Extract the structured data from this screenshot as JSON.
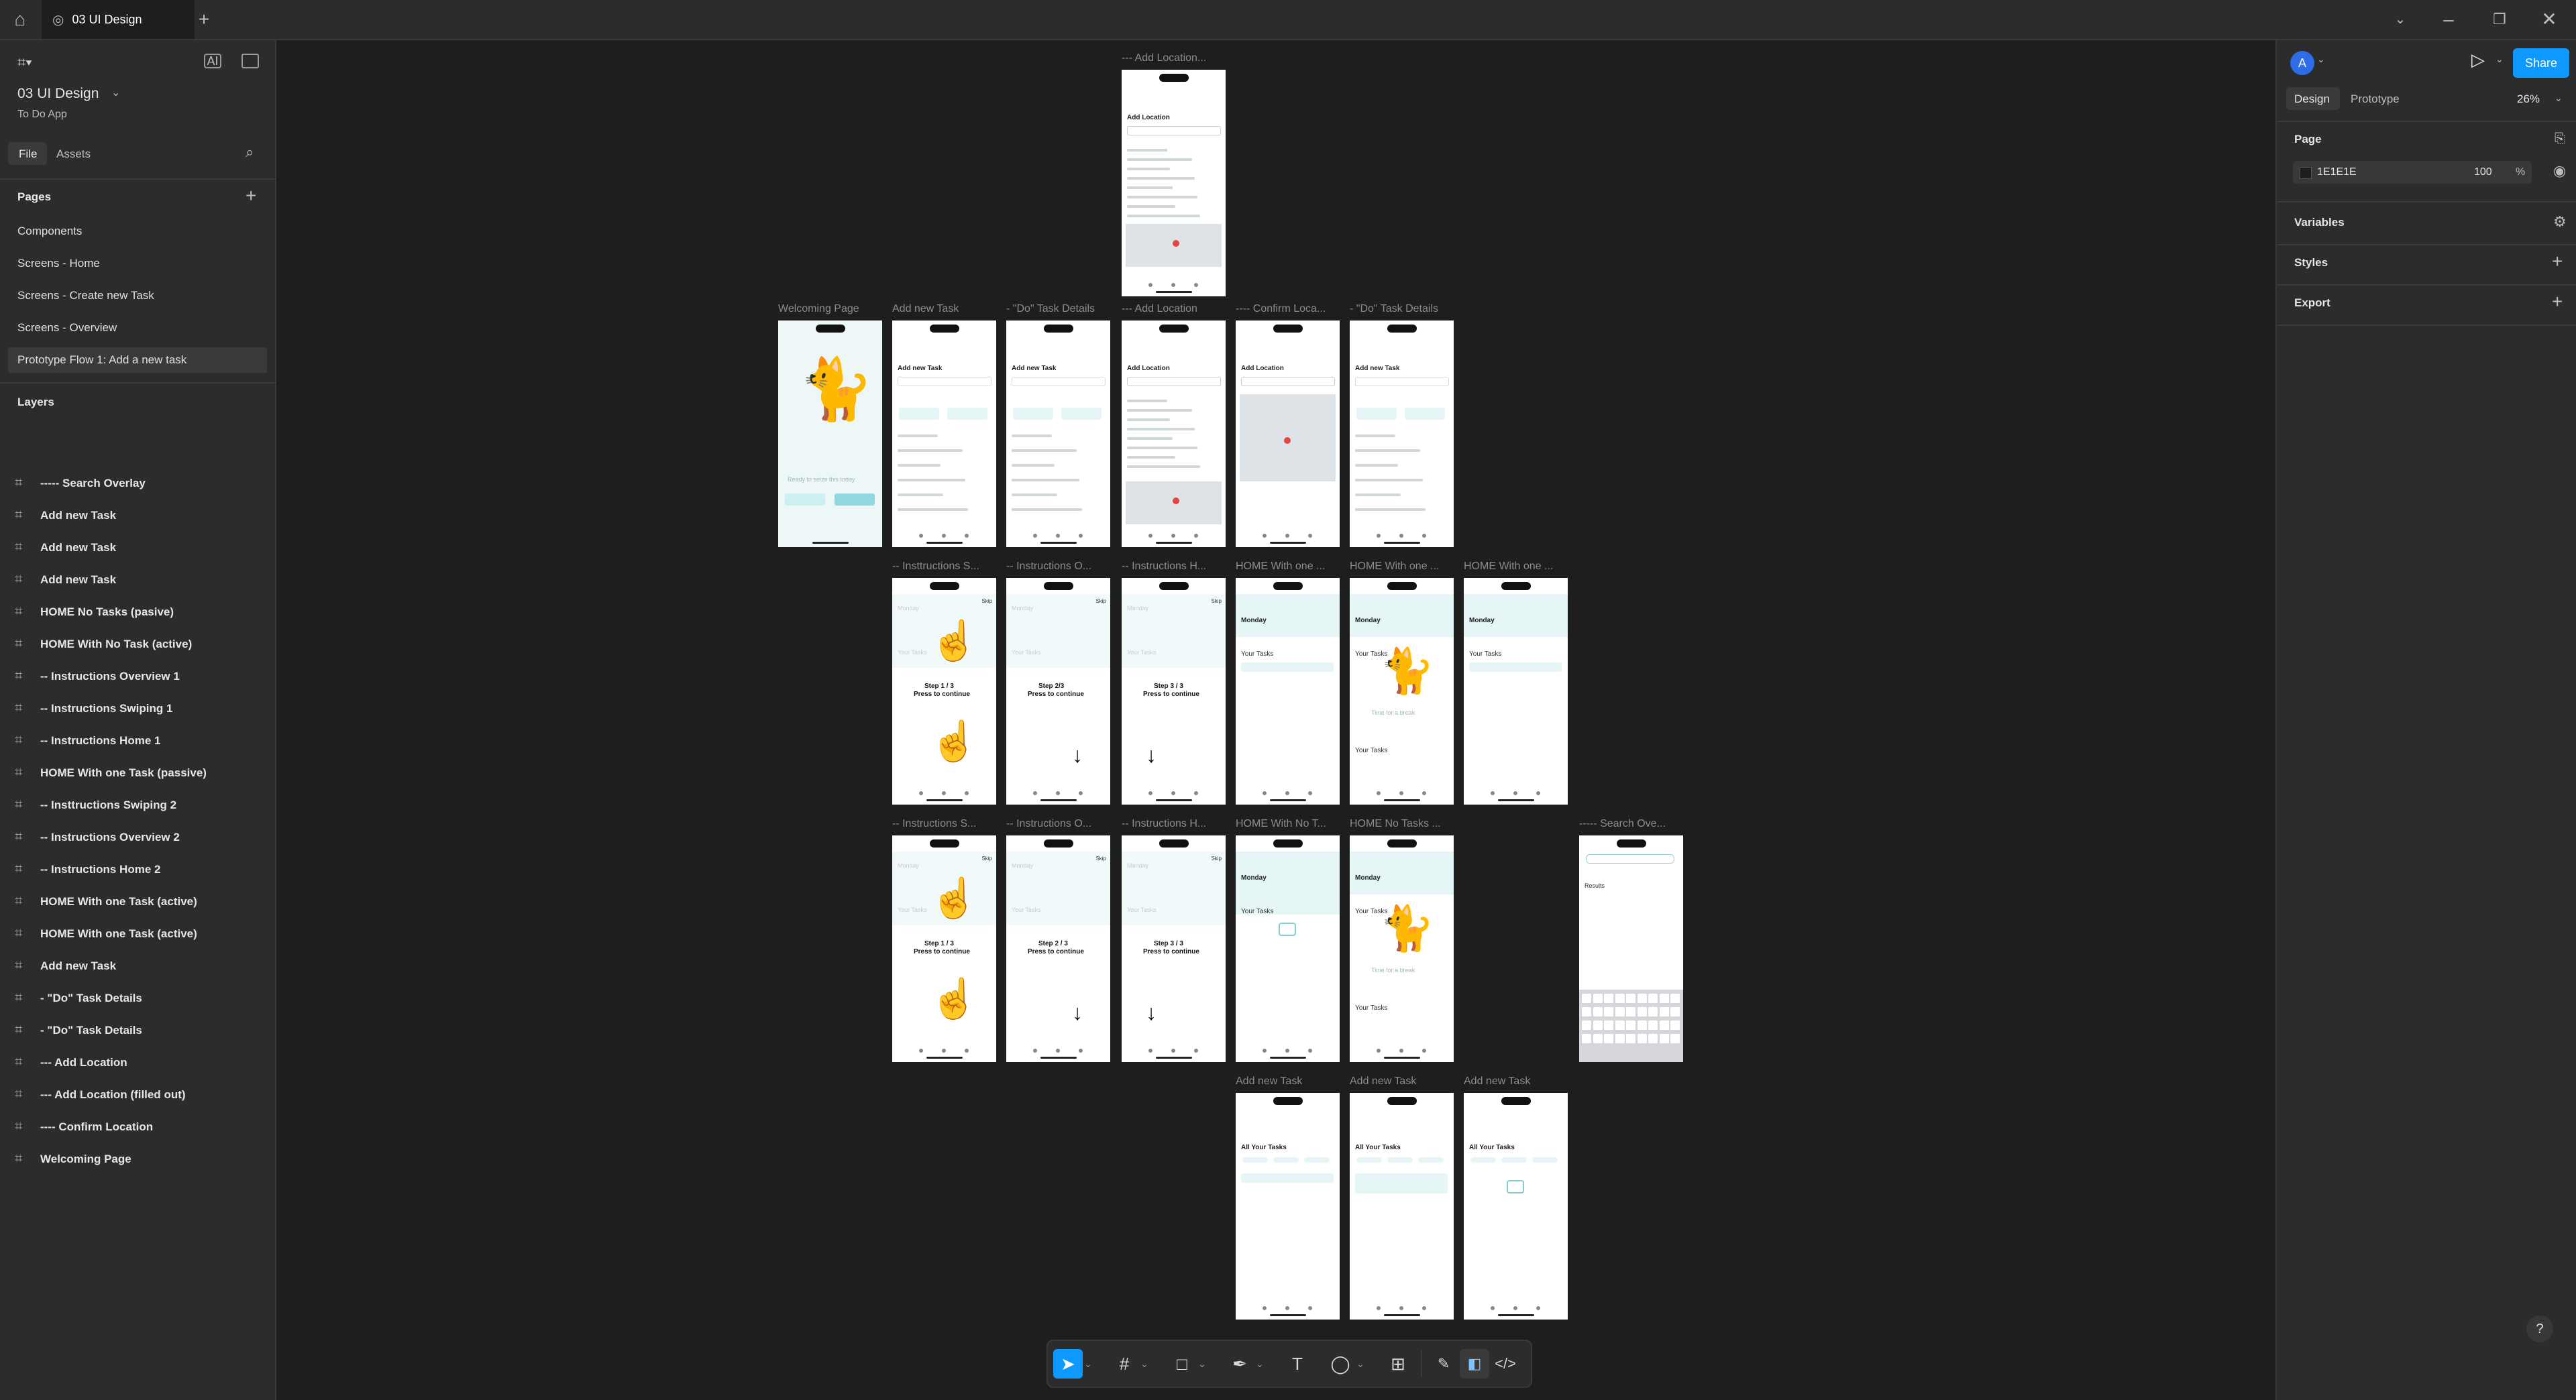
{
  "titlebar": {
    "tab_title": "03 UI Design",
    "home_icon": "home-icon",
    "new_tab": "+",
    "window_buttons": [
      "chevron-down-icon",
      "minimize-icon",
      "maximize-icon",
      "close-icon"
    ]
  },
  "left": {
    "file_name": "03 UI Design",
    "project": "To Do App",
    "tabs": [
      "File",
      "Assets"
    ],
    "pages_heading": "Pages",
    "pages": [
      "Components",
      "Screens - Home",
      "Screens - Create new Task",
      "Screens - Overview",
      "Prototype Flow 1: Add a new task"
    ],
    "active_page": "Prototype Flow 1: Add a new task",
    "layers_heading": "Layers",
    "layers": [
      "----- Search Overlay",
      "Add new Task",
      "Add new Task",
      "Add new Task",
      "HOME No Tasks (pasive)",
      "HOME With No Task (active)",
      "-- Instructions Overview 1",
      "-- Instructions Swiping 1",
      "-- Instructions Home 1",
      "HOME With one Task (passive)",
      "-- Insttructions Swiping 2",
      "-- Instructions Overview 2",
      "-- Instructions Home 2",
      "HOME With one Task (active)",
      "HOME With one Task (active)",
      "Add new Task",
      "- \"Do\" Task Details",
      "- \"Do\" Task Details",
      "--- Add Location",
      "--- Add Location (filled out)",
      "---- Confirm Location",
      "Welcoming Page"
    ]
  },
  "right": {
    "avatar_letter": "A",
    "share": "Share",
    "tabs": [
      "Design",
      "Prototype"
    ],
    "zoom": "26%",
    "page_heading": "Page",
    "bg_color_hex": "1E1E1E",
    "bg_opacity": "100",
    "percent": "%",
    "sections": [
      "Variables",
      "Styles",
      "Export"
    ]
  },
  "canvas": {
    "frame_labels": [
      "--- Add Location...",
      "Welcoming Page",
      "Add new Task",
      "- \"Do\" Task Details",
      "--- Add Location",
      "---- Confirm Loca...",
      "- \"Do\" Task Details",
      "-- Insttructions S...",
      "-- Instructions O...",
      "-- Instructions H...",
      "HOME With one ...",
      "HOME With one ...",
      "HOME With one ...",
      "-- Instructions S...",
      "-- Instructions O...",
      "-- Instructions H...",
      "HOME With No T...",
      "HOME No Tasks ...",
      "----- Search Ove...",
      "Add new Task",
      "Add new Task",
      "Add new Task"
    ],
    "frame_text": {
      "add_location": "Add Location",
      "add_new_task": "Add new Task",
      "ready": "Ready to seize this today",
      "monday": "Monday",
      "your_tasks": "Your Tasks",
      "all_your_tasks": "All Your Tasks",
      "time_for_break": "Time for a break",
      "step1": "Step 1 / 3",
      "step2": "Step 2 / 3",
      "step2b": "Step 2/3",
      "step3": "Step 3 / 3",
      "press": "Press to continue",
      "results": "Results",
      "skip": "Skip"
    }
  },
  "toolbar": {
    "tools": [
      "move-tool-icon",
      "frame-tool-icon",
      "shape-tool-icon",
      "pen-tool-icon",
      "text-tool-icon",
      "comment-tool-icon",
      "actions-icon",
      "draw-mode-icon",
      "design-mode-icon",
      "dev-mode-icon"
    ]
  },
  "help": "?"
}
